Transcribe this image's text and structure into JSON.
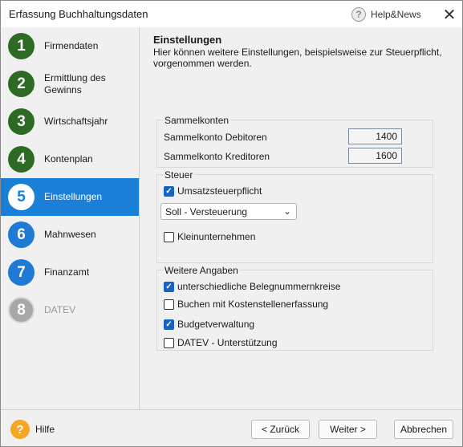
{
  "window": {
    "title": "Erfassung Buchhaltungsdaten",
    "help_news_label": "Help&News",
    "close_glyph": "✕"
  },
  "steps": [
    {
      "number": "1",
      "label": "Firmendaten",
      "state": "done"
    },
    {
      "number": "2",
      "label": "Ermittlung des Gewinns",
      "state": "done"
    },
    {
      "number": "3",
      "label": "Wirtschaftsjahr",
      "state": "done"
    },
    {
      "number": "4",
      "label": "Kontenplan",
      "state": "done"
    },
    {
      "number": "5",
      "label": "Einstellungen",
      "state": "active"
    },
    {
      "number": "6",
      "label": "Mahnwesen",
      "state": "todo"
    },
    {
      "number": "7",
      "label": "Finanzamt",
      "state": "todo"
    },
    {
      "number": "8",
      "label": "DATEV",
      "state": "disabled"
    }
  ],
  "main": {
    "heading": "Einstellungen",
    "subtitle": "Hier können weitere Einstellungen, beispielsweise zur Steuerpflicht, vorgenommen werden."
  },
  "sammelkonten": {
    "title": "Sammelkonten",
    "debitoren_label": "Sammelkonto Debitoren",
    "debitoren_value": "1400",
    "kreditoren_label": "Sammelkonto Kreditoren",
    "kreditoren_value": "1600"
  },
  "steuer": {
    "title": "Steuer",
    "umsatzsteuer_label": "Umsatzsteuerpflicht",
    "umsatzsteuer_checked": true,
    "versteuerung_selected": "Soll - Versteuerung",
    "kleinunternehmen_label": "Kleinunternehmen",
    "kleinunternehmen_checked": false
  },
  "weitere": {
    "title": "Weitere Angaben",
    "items": [
      {
        "label": "unterschiedliche Belegnummernkreise",
        "checked": true
      },
      {
        "label": "Buchen mit Kostenstellenerfassung",
        "checked": false
      },
      {
        "label": "Budgetverwaltung",
        "checked": true
      },
      {
        "label": "DATEV - Unterstützung",
        "checked": false
      }
    ]
  },
  "footer": {
    "hilfe_label": "Hilfe",
    "back_label": "< Zurück",
    "next_label": "Weiter >",
    "cancel_label": "Abbrechen"
  },
  "colors": {
    "active_step": "#1a7fd6",
    "done_step": "#2d6b24",
    "todo_step": "#1e7ad4",
    "checkbox_checked": "#1763c4",
    "help_icon": "#f5a623"
  }
}
